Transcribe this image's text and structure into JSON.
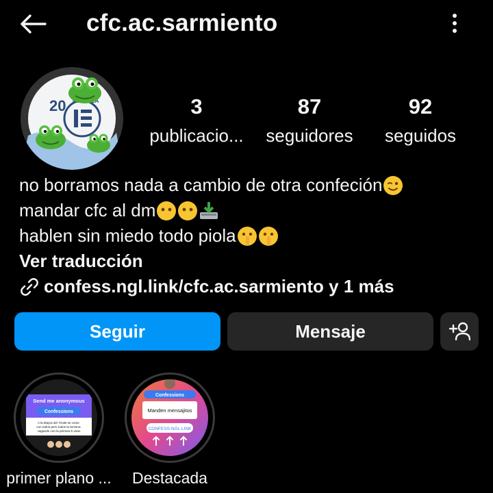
{
  "header": {
    "username": "cfc.ac.sarmiento",
    "back_icon": "arrow-left-icon",
    "more_icon": "more-vertical-icon"
  },
  "profile": {
    "avatar_text": "20",
    "avatar_ring_text": "ESCUELA",
    "stats": [
      {
        "value": "3",
        "label": "publicacio..."
      },
      {
        "value": "87",
        "label": "seguidores"
      },
      {
        "value": "92",
        "label": "seguidos"
      }
    ]
  },
  "bio": {
    "line1": "no borramos nada a cambio de otra confeción",
    "line2": "mandar cfc al dm",
    "line3": "hablen sin miedo todo piola ",
    "translate": "Ver traducción",
    "link": "confess.ngl.link/cfc.ac.sarmiento y 1 más"
  },
  "actions": {
    "follow": "Seguir",
    "message": "Mensaje",
    "add_user_icon": "add-user-icon"
  },
  "highlights": [
    {
      "label": "primer plano ...",
      "card_title": "Send me anonymous",
      "card_badge": "Confessions",
      "card_text": "A la Mayra del 7moB se come con todos pero todos la termina cagando con la primera k vean"
    },
    {
      "label": "Destacada",
      "card_badge": "Confessions",
      "card_text": "Manden mensajitos",
      "card_link": "CONFESS.NGL.LINK"
    }
  ],
  "colors": {
    "background": "#000000",
    "follow_button": "#0095f6",
    "secondary_button": "#262626",
    "text": "#f5f5f5"
  }
}
